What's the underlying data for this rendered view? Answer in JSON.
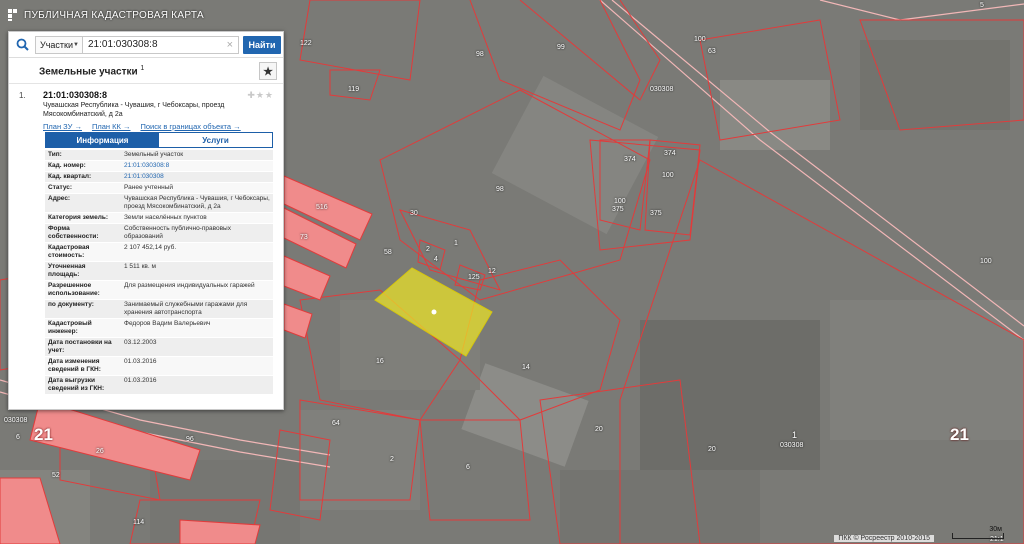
{
  "header": {
    "title": "ПУБЛИЧНАЯ КАДАСТРОВАЯ КАРТА"
  },
  "search": {
    "type_label": "Участки",
    "query": "21:01:030308:8",
    "find_label": "Найти"
  },
  "results": {
    "title": "Земельные участки",
    "count": "1",
    "item": {
      "index": "1.",
      "number": "21:01:030308:8",
      "address": "Чувашская Республика - Чувашия, г Чебоксары, проезд Мясокомбинатский, д 2а",
      "links": [
        "План ЗУ →",
        "План КК →",
        "Поиск в границах объекта →"
      ]
    }
  },
  "tabs": {
    "info": "Информация",
    "services": "Услуги"
  },
  "info_rows": [
    {
      "k": "Тип:",
      "v": "Земельный участок"
    },
    {
      "k": "Кад. номер:",
      "v": "21:01:030308:8",
      "link": true
    },
    {
      "k": "Кад. квартал:",
      "v": "21:01:030308",
      "link": true
    },
    {
      "k": "Статус:",
      "v": "Ранее учтенный"
    },
    {
      "k": "Адрес:",
      "v": "Чувашская Республика - Чувашия, г Чебоксары, проезд Мясокомбинатский, д 2а"
    },
    {
      "k": "Категория земель:",
      "v": "Земли населённых пунктов"
    },
    {
      "k": "Форма собственности:",
      "v": "Собственность публично-правовых образований"
    },
    {
      "k": "Кадастровая стоимость:",
      "v": "2 107 452,14 руб."
    },
    {
      "k": "Уточненная площадь:",
      "v": "1 511 кв. м"
    },
    {
      "k": "Разрешенное использование:",
      "v": "Для размещения индивидуальных гаражей"
    },
    {
      "k": "по документу:",
      "v": "Занимаемый служебными гаражами для хранения автотранспорта"
    },
    {
      "k": "Кадастровый инженер:",
      "v": "Федоров Вадим Валерьевич"
    },
    {
      "k": "Дата постановки на учет:",
      "v": "03.12.2003"
    },
    {
      "k": "Дата изменения сведений в ГКН:",
      "v": "01.03.2016"
    },
    {
      "k": "Дата выгрузки сведений из ГКН:",
      "v": "01.03.2016"
    }
  ],
  "map_labels": [
    "98",
    "99",
    "100",
    "63",
    "119",
    "122",
    "123",
    "30",
    "58",
    "1",
    "12",
    "2",
    "4",
    "125",
    "98",
    "374",
    "374",
    "100",
    "100",
    "375",
    "375",
    "100",
    "16",
    "14",
    "20",
    "64",
    "6",
    "52",
    "516",
    "114",
    "26",
    "20",
    "96",
    "73",
    "030308",
    "21",
    "21",
    "1",
    "030308",
    "6",
    "5",
    "2",
    "21:1",
    "030308"
  ],
  "footer": {
    "copyright": "ПКК © Росреестр 2010-2015",
    "scale": "30м"
  },
  "colors": {
    "accent": "#1d5fa8",
    "parcel_outline": "#e23b3b",
    "selected_parcel": "#e8e02a"
  }
}
